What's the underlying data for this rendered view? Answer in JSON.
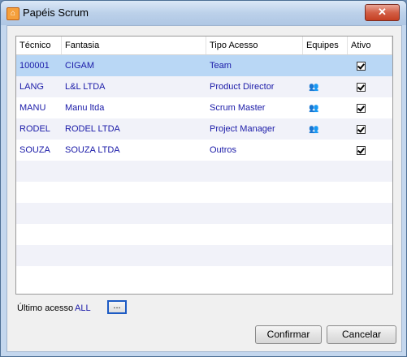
{
  "window": {
    "title": "Papéis Scrum",
    "close_glyph": "✕",
    "icon": "app-icon"
  },
  "grid": {
    "columns": [
      "Técnico",
      "Fantasia",
      "Tipo Acesso",
      "Equipes",
      "Ativo"
    ],
    "rows": [
      {
        "tecnico": "100001",
        "fantasia": "CIGAM",
        "tipo": "Team",
        "equipes": false,
        "ativo": true,
        "selected": true
      },
      {
        "tecnico": "LANG",
        "fantasia": "L&L LTDA",
        "tipo": "Product Director",
        "equipes": true,
        "ativo": true
      },
      {
        "tecnico": "MANU",
        "fantasia": "Manu ltda",
        "tipo": "Scrum Master",
        "equipes": true,
        "ativo": true
      },
      {
        "tecnico": "RODEL",
        "fantasia": "RODEL LTDA",
        "tipo": "Project Manager",
        "equipes": true,
        "ativo": true
      },
      {
        "tecnico": "SOUZA",
        "fantasia": "SOUZA LTDA",
        "tipo": "Outros",
        "equipes": false,
        "ativo": true
      }
    ]
  },
  "footer": {
    "last_access_label": "Último acesso",
    "last_access_value": "ALL",
    "ellipsis_label": "..."
  },
  "buttons": {
    "confirm": "Confirmar",
    "cancel": "Cancelar"
  },
  "colors": {
    "selected_row": "#b9d7f5",
    "link_text": "#1a1aa8"
  }
}
